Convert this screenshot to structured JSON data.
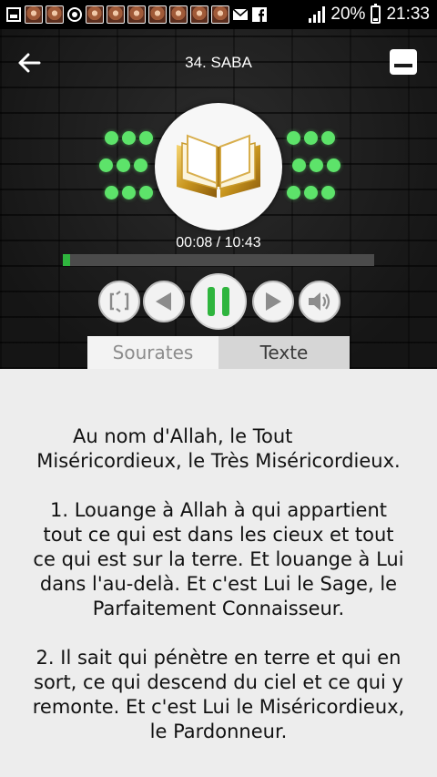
{
  "status_bar": {
    "battery": "20%",
    "time": "21:33"
  },
  "header": {
    "title": "34. SABA"
  },
  "player": {
    "elapsed": "00:08",
    "duration": "10:43",
    "time_text": "00:08 / 10:43",
    "progress_fraction": 0.0124,
    "state": "playing"
  },
  "tabs": {
    "items": [
      {
        "label": "Sourates",
        "active": false
      },
      {
        "label": "Texte",
        "active": true
      }
    ]
  },
  "content": {
    "lines": [
      "Au nom d'Allah, le Tout",
      "Miséricordieux, le Très Miséricordieux.",
      "1. Louange à Allah à qui appartient",
      "tout ce qui est dans les cieux et tout",
      "ce qui est sur la terre. Et louange à Lui",
      "dans l'au-delà. Et c'est Lui le Sage, le",
      "Parfaitement Connaisseur.",
      "2. Il sait qui pénètre en terre et qui en",
      "sort, ce qui descend du ciel et ce qui y",
      "remonte. Et c'est Lui le Miséricordieux,",
      "le Pardonneur."
    ]
  },
  "colors": {
    "accent_green": "#2fb53e",
    "dot_green": "#5de36a",
    "background_dark": "#1d1d1d",
    "text_background": "#ededed"
  },
  "icons": {
    "back": "arrow-left-icon",
    "menu": "menu-icon",
    "repeat": "repeat-icon",
    "previous": "previous-icon",
    "pause": "pause-icon",
    "next": "next-icon",
    "volume": "volume-icon",
    "quran": "quran-book-icon"
  }
}
